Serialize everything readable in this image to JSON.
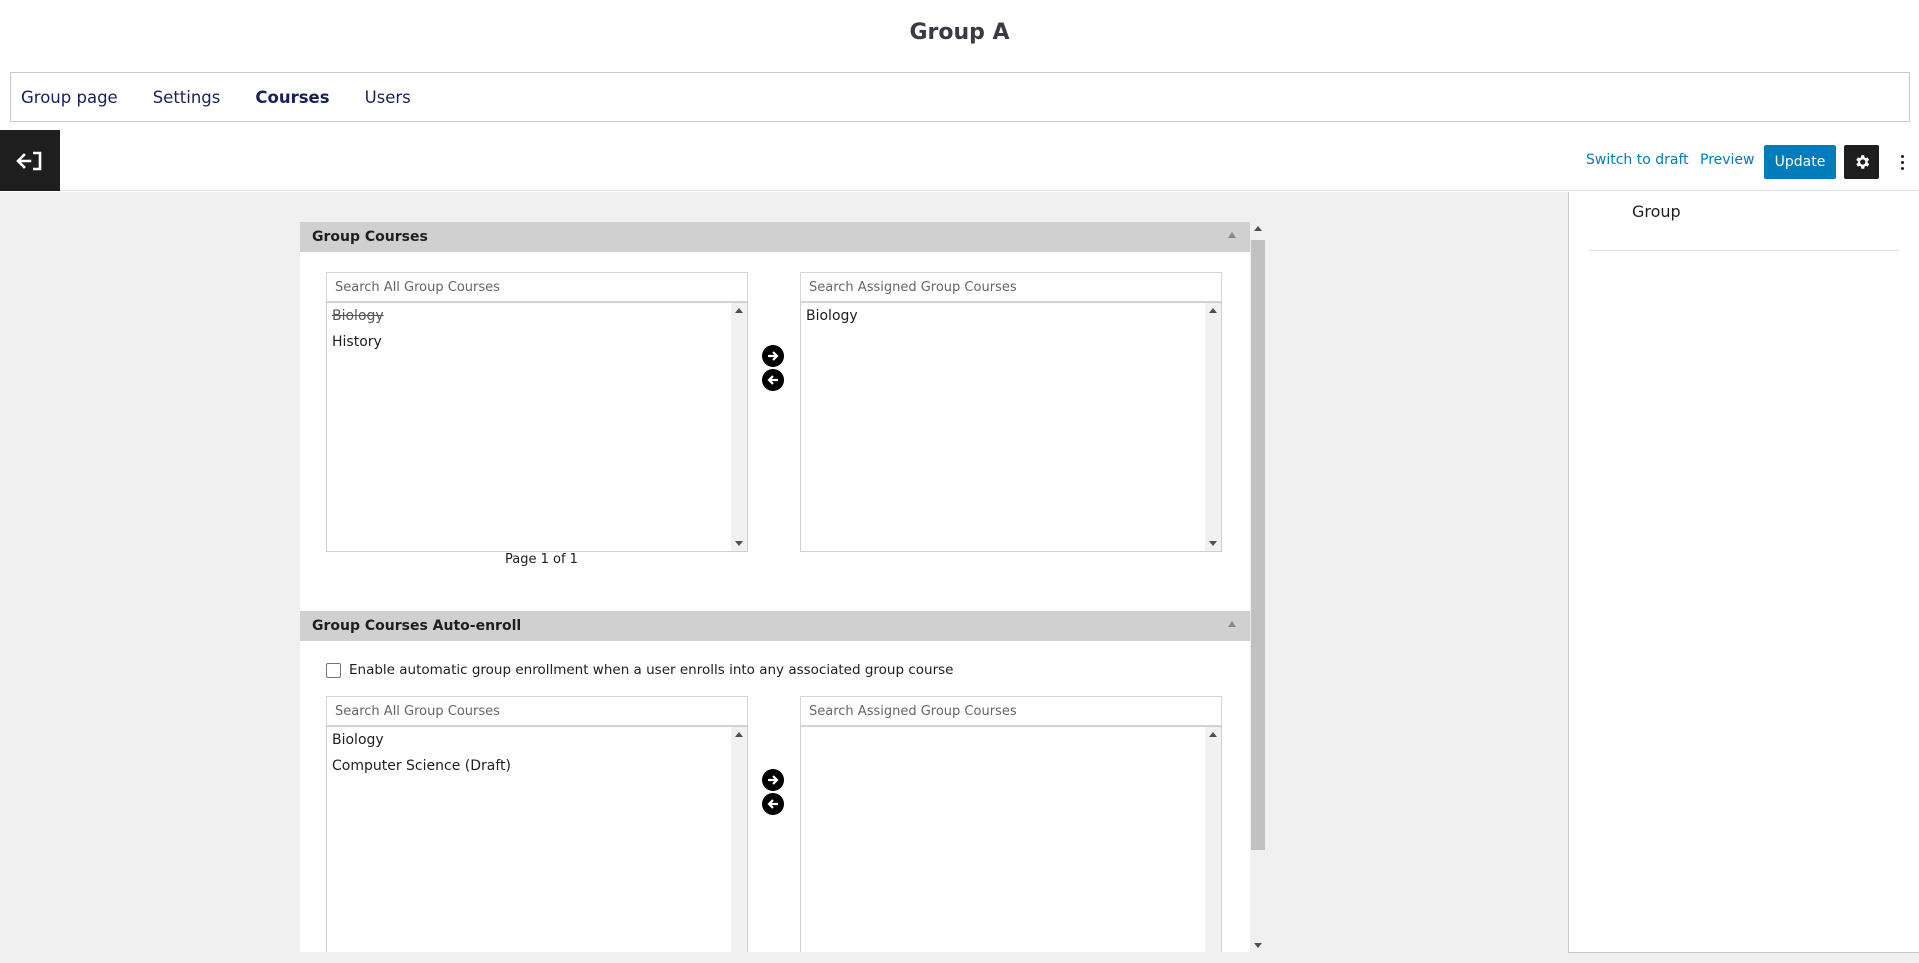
{
  "page": {
    "title": "Group A"
  },
  "tabs": [
    {
      "label": "Group page",
      "active": false
    },
    {
      "label": "Settings",
      "active": false
    },
    {
      "label": "Courses",
      "active": true
    },
    {
      "label": "Users",
      "active": false
    }
  ],
  "toolbar": {
    "switch_to_draft": "Switch to draft",
    "preview": "Preview",
    "update": "Update",
    "accent_color": "#007cba"
  },
  "group_courses": {
    "title": "Group Courses",
    "search_all_placeholder": "Search All Group Courses",
    "search_assigned_placeholder": "Search Assigned Group Courses",
    "all_items": [
      {
        "label": "Biology",
        "strikethrough": true
      },
      {
        "label": "History",
        "strikethrough": false
      }
    ],
    "assigned_items": [
      {
        "label": "Biology"
      }
    ],
    "pager": "Page 1 of 1"
  },
  "auto_enroll": {
    "title": "Group Courses Auto-enroll",
    "checkbox_label": "Enable automatic group enrollment when a user enrolls into any associated group course",
    "checked": false,
    "search_all_placeholder": "Search All Group Courses",
    "search_assigned_placeholder": "Search Assigned Group Courses",
    "all_items": [
      {
        "label": "Biology"
      },
      {
        "label": "Computer Science (Draft)"
      }
    ],
    "assigned_items": []
  },
  "sidebar": {
    "title": "Group"
  },
  "icons": {
    "back": "exit-to-left-icon",
    "settings": "gear-icon",
    "more": "kebab-menu-icon",
    "move_right": "arrow-right-circle-icon",
    "move_left": "arrow-left-circle-icon"
  }
}
